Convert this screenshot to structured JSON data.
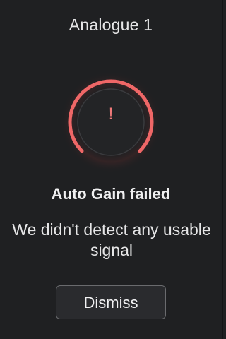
{
  "window": {
    "title": "Analogue 1"
  },
  "status": {
    "icon": "warning-exclamation-icon",
    "icon_glyph": "!",
    "heading": "Auto Gain failed",
    "message": "We didn't detect any usable signal"
  },
  "actions": {
    "dismiss_label": "Dismiss"
  },
  "colors": {
    "background": "#1f2022",
    "error_ring": "#ef6767",
    "error_glyph": "#f07979",
    "button_border": "#6a6b6e"
  }
}
